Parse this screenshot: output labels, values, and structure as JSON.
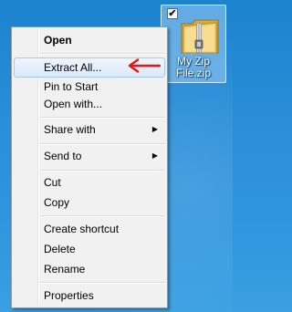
{
  "desktop_icon": {
    "caption_line1": "My Zip",
    "caption_line2": "File.zip",
    "checked_mark": "✔",
    "icon": "zip-folder-icon"
  },
  "context_menu": {
    "items": [
      {
        "label": "Open",
        "bold": true
      },
      {
        "label": "Extract All...",
        "highlighted": true
      },
      {
        "label": "Pin to Start"
      },
      {
        "label": "Open with..."
      },
      {
        "label": "Share with",
        "submenu": true
      },
      {
        "label": "Send to",
        "submenu": true
      },
      {
        "label": "Cut"
      },
      {
        "label": "Copy"
      },
      {
        "label": "Create shortcut"
      },
      {
        "label": "Delete"
      },
      {
        "label": "Rename"
      },
      {
        "label": "Properties"
      }
    ],
    "submenu_arrow": "▶"
  },
  "annotation": {
    "icon": "red-left-arrow-icon",
    "color": "#e8161a"
  },
  "colors": {
    "desktop": "#2a8ed8",
    "menu_bg": "#f1f1f1",
    "highlight_border": "#a8c8ee"
  }
}
